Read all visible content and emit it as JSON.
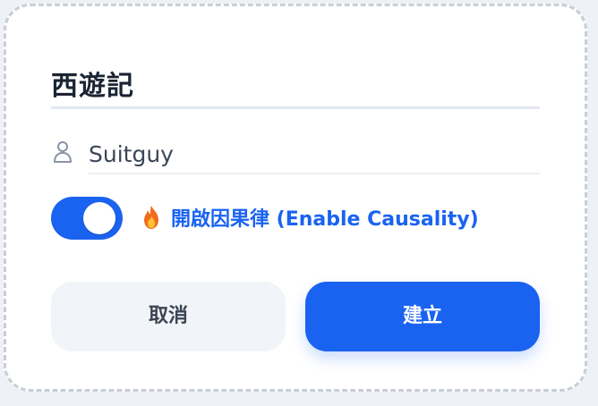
{
  "dialog": {
    "title": "西遊記",
    "user": {
      "icon": "user-icon",
      "name": "Suitguy"
    },
    "causality": {
      "enabled": true,
      "icon": "flame-icon",
      "label": "開啟因果律 (Enable Causality)"
    },
    "buttons": {
      "cancel_label": "取消",
      "create_label": "建立"
    }
  },
  "colors": {
    "accent": "#1a63f0",
    "title_text": "#1b2433",
    "cancel_bg": "#f1f4f8",
    "border": "#c9ced6"
  }
}
